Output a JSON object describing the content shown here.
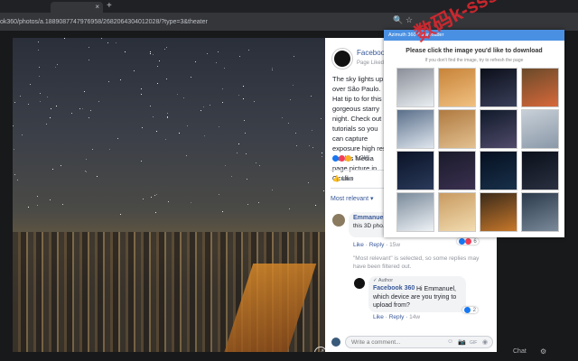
{
  "browser": {
    "url": "ok360/photos/a.1889087747976958/2682064304012028/?type=3&theater"
  },
  "post": {
    "page_name": "Facebook 360",
    "page_sub": "Page Liked",
    "text": "The sky lights up over São Paulo. Hat tip to for this gorgeous starry night. Check out tutorials so you can capture exposure high res Oculus Media page picture in Oculus",
    "reaction_count": "5.2K",
    "like_label": "Like",
    "most_relevant": "Most relevant ▾"
  },
  "comment": {
    "author": "Emmanuel",
    "text": "this 3D pho... account... Please...",
    "like": "Like",
    "reply": "Reply",
    "time": "15w",
    "reactions": "6"
  },
  "filtered_notice": "\"Most relevant\" is selected, so some replies may have been filtered out.",
  "reply": {
    "author_badge": "✓ Author",
    "author": "Facebook 360",
    "text": "Hi Emmanuel, which device are you trying to upload from?",
    "like": "Like",
    "reply": "Reply",
    "time": "14w",
    "reactions": "2"
  },
  "composer": {
    "placeholder": "Write a comment..."
  },
  "chat_label": "Chat",
  "extension": {
    "header": "Azimuth 360 Downloader",
    "title": "Please click the image you'd like to download",
    "hint": "If you don't find the image, try to refresh the page"
  },
  "watermark": "数码k-sss66",
  "colors": {
    "fb_blue": "#385898",
    "ext_header": "#4a90e2",
    "watermark": "#e6262e"
  },
  "icons": {
    "tab_close": "×",
    "new_tab": "+",
    "zoom": "🔍",
    "bookmark": "☆",
    "expand": "⤢",
    "like": "👍",
    "emoji": "☺",
    "camera": "📷",
    "gif": "GIF",
    "sticker": "◉"
  }
}
